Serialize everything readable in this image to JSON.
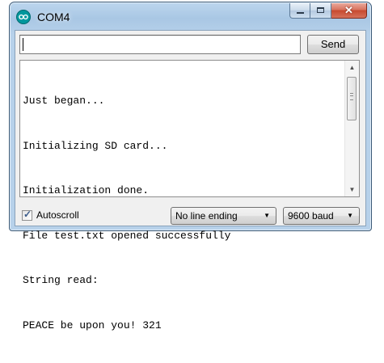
{
  "window": {
    "title": "COM4",
    "app_icon": "arduino-infinity-icon",
    "caption_buttons": {
      "minimize_icon": "minimize-icon",
      "maximize_icon": "maximize-icon",
      "close_icon": "close-icon",
      "close_glyph": "✕"
    }
  },
  "send_bar": {
    "input_value": "",
    "send_label": "Send"
  },
  "output": {
    "lines": [
      "Just began...",
      "Initializing SD card...",
      "Initialization done.",
      "File test.txt opened successfully",
      "String read:",
      "PEACE be upon you! 321"
    ],
    "scroll_up_glyph": "▲",
    "scroll_down_glyph": "▼"
  },
  "footer": {
    "autoscroll_label": "Autoscroll",
    "autoscroll_checked": true,
    "check_glyph": "✓",
    "line_ending_selected": "No line ending",
    "baud_selected": "9600 baud",
    "dropdown_arrow_glyph": "▼"
  },
  "colors": {
    "title_bar": "#a9c7e4",
    "close_button": "#c74a2f",
    "arduino_teal": "#00979d"
  }
}
